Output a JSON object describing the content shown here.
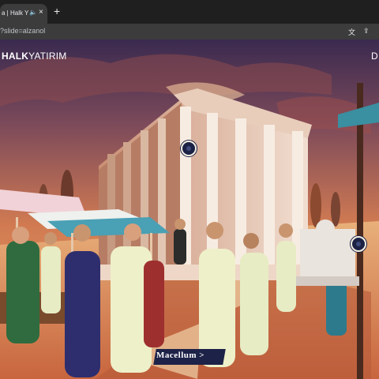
{
  "browser": {
    "tab_title": "a | Halk Ya",
    "new_tab_symbol": "+",
    "close_symbol": "×",
    "audio_symbol": "🔈",
    "url": "?slide=alzanol",
    "translate_glyph": "文",
    "share_glyph": "⇪"
  },
  "header": {
    "brand_strong": "HALK",
    "brand_light": "YATIRIM",
    "corner_text": "D"
  },
  "scene": {
    "location_label": "Macellum >"
  },
  "icons": [
    "audio-icon",
    "close-icon",
    "new-tab-icon",
    "translate-icon",
    "share-icon",
    "hotspot-icon"
  ]
}
